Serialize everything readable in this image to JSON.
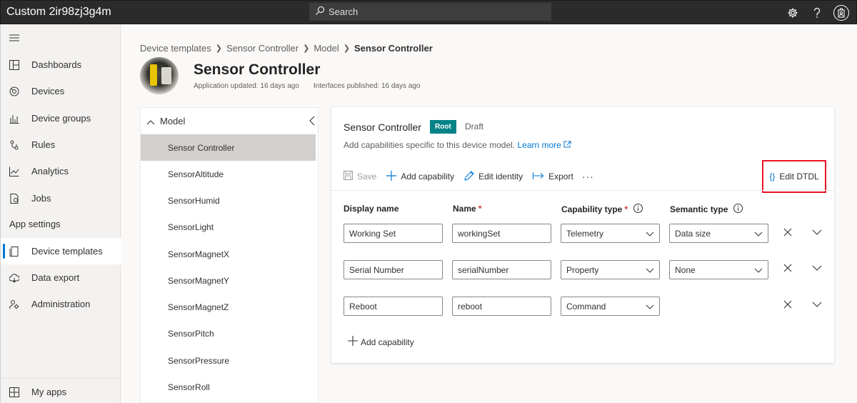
{
  "app": {
    "title": "Custom 2ir98zj3g4m"
  },
  "search": {
    "label": "Search"
  },
  "sidebar": {
    "items": [
      {
        "label": "Dashboards"
      },
      {
        "label": "Devices"
      },
      {
        "label": "Device groups"
      },
      {
        "label": "Rules"
      },
      {
        "label": "Analytics"
      },
      {
        "label": "Jobs"
      }
    ],
    "section_label": "App settings",
    "settings_items": [
      {
        "label": "Device templates"
      },
      {
        "label": "Data export"
      },
      {
        "label": "Administration"
      }
    ],
    "bottom_item": "My apps"
  },
  "breadcrumb": [
    "Device templates",
    "Sensor Controller",
    "Model",
    "Sensor Controller"
  ],
  "page": {
    "title": "Sensor Controller",
    "app_updated": "Application updated: 16 days ago",
    "interfaces_published": "Interfaces published: 16 days ago"
  },
  "tree": {
    "header": "Model",
    "items": [
      "Sensor Controller",
      "SensorAltitude",
      "SensorHumid",
      "SensorLight",
      "SensorMagnetX",
      "SensorMagnetY",
      "SensorMagnetZ",
      "SensorPitch",
      "SensorPressure",
      "SensorRoll"
    ]
  },
  "card": {
    "title": "Sensor Controller",
    "badge": "Root",
    "status": "Draft",
    "description": "Add capabilities specific to this device model.",
    "learn_more": "Learn more",
    "toolbar": {
      "save": "Save",
      "add_capability": "Add capability",
      "edit_identity": "Edit identity",
      "export": "Export",
      "more": "···",
      "edit_dtdl": "Edit DTDL"
    },
    "columns": {
      "display_name": "Display name",
      "name": "Name",
      "capability_type": "Capability type",
      "semantic_type": "Semantic type",
      "required_mark": "*"
    },
    "rows": [
      {
        "display_name": "Working Set",
        "name": "workingSet",
        "capability_type": "Telemetry",
        "semantic_type": "Data size"
      },
      {
        "display_name": "Serial Number",
        "name": "serialNumber",
        "capability_type": "Property",
        "semantic_type": "None"
      },
      {
        "display_name": "Reboot",
        "name": "reboot",
        "capability_type": "Command",
        "semantic_type": ""
      }
    ],
    "add_capability_bottom": "Add capability"
  }
}
